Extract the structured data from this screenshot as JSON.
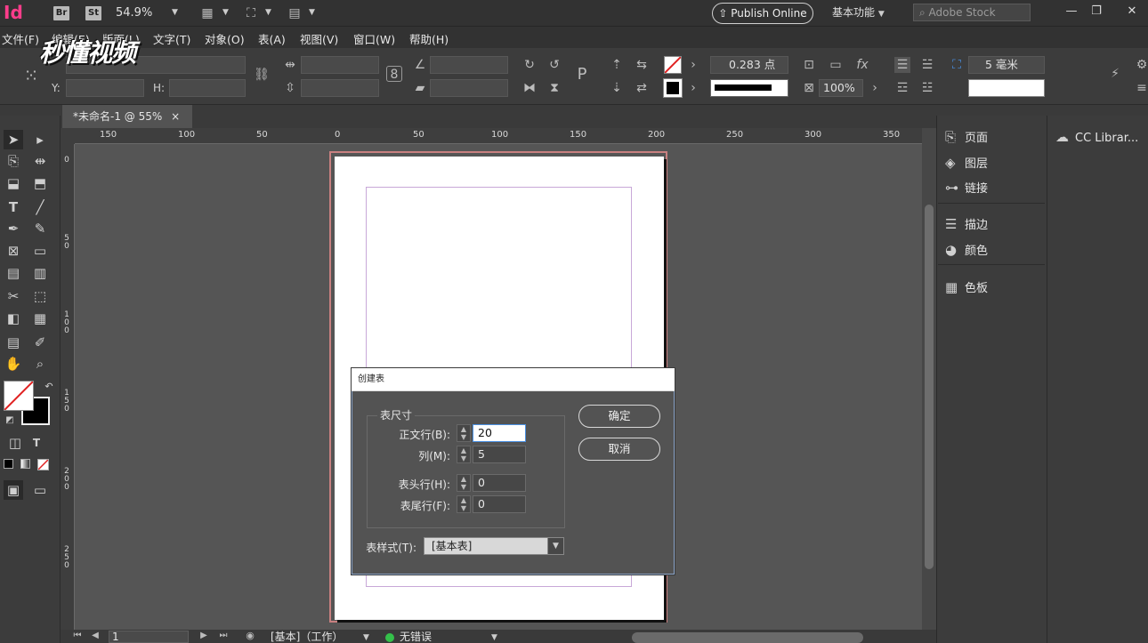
{
  "app": {
    "logo": "Id",
    "bridge_badge": "Br",
    "stock_badge": "St",
    "zoom": "54.9%",
    "publish_label": "Publish Online",
    "workspace": "基本功能",
    "search_placeholder": "Adobe Stock"
  },
  "menu": [
    "文件(F)",
    "编辑(E)",
    "版面(L)",
    "文字(T)",
    "对象(O)",
    "表(A)",
    "视图(V)",
    "窗口(W)",
    "帮助(H)"
  ],
  "watermark": "秒懂视频",
  "control": {
    "y_label": "Y:",
    "h_label": "H:",
    "stroke_weight": "0.283 点",
    "scale_percent": "100%",
    "gap_value": "5 毫米"
  },
  "document_tab": {
    "title": "*未命名-1 @ 55%",
    "close": "×"
  },
  "ruler": {
    "h_ticks": [
      "150",
      "100",
      "50",
      "0",
      "50",
      "100",
      "150",
      "200",
      "250",
      "300",
      "350"
    ],
    "v_ticks": [
      "0",
      "5\n0",
      "1\n0\n0",
      "1\n5\n0",
      "2\n0\n0",
      "2\n5\n0"
    ]
  },
  "panels": {
    "group1": [
      "页面",
      "图层",
      "链接"
    ],
    "group2": [
      "描边",
      "颜色"
    ],
    "group3": [
      "色板"
    ],
    "cc": "CC Librar..."
  },
  "status": {
    "page": "1",
    "style": "[基本]（工作）",
    "preflight": "无错误"
  },
  "dialog": {
    "title": "创建表",
    "group_label": "表尺寸",
    "body_rows_label": "正文行(B):",
    "body_rows": "20",
    "columns_label": "列(M):",
    "columns": "5",
    "header_rows_label": "表头行(H):",
    "header_rows": "0",
    "footer_rows_label": "表尾行(F):",
    "footer_rows": "0",
    "table_style_label": "表样式(T):",
    "table_style": "[基本表]",
    "ok": "确定",
    "cancel": "取消"
  }
}
